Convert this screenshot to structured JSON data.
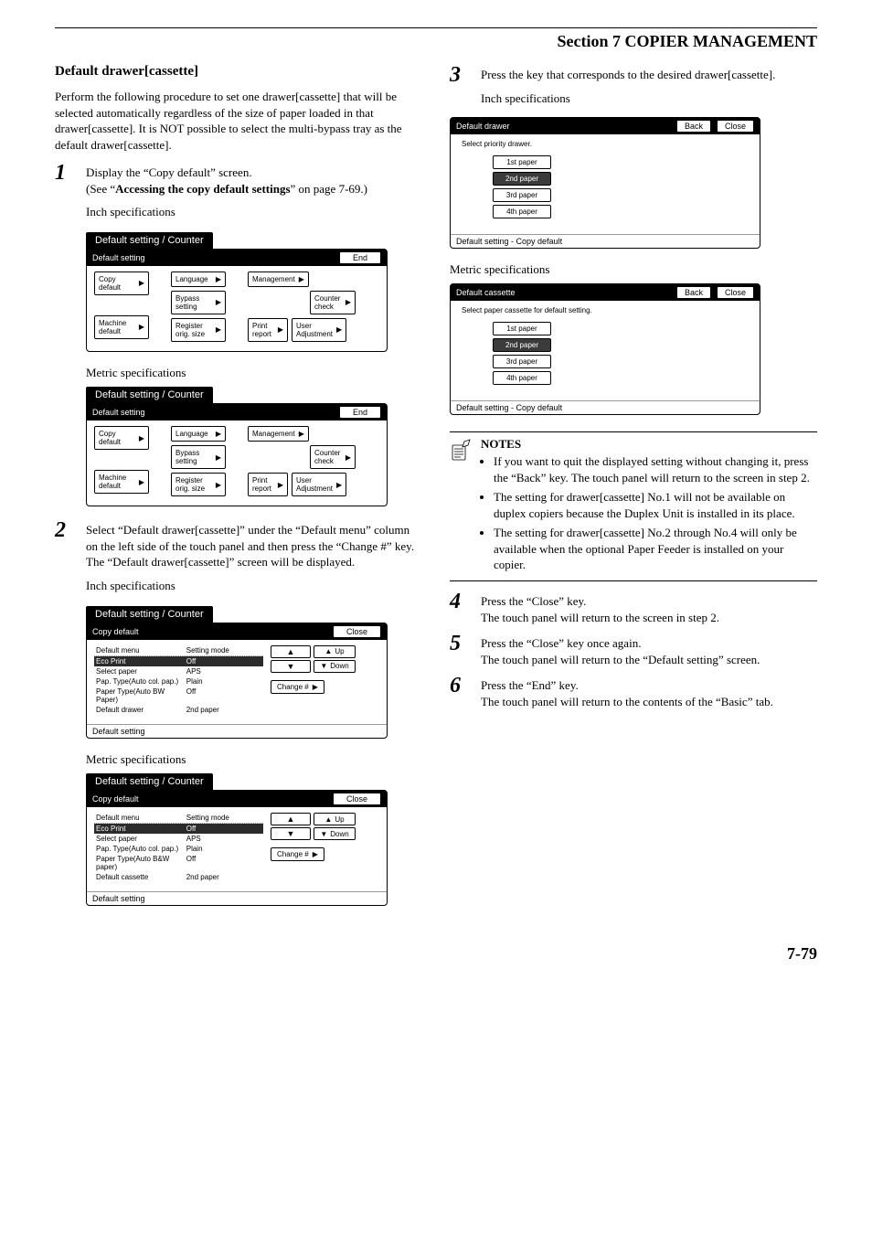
{
  "header": "Section 7  COPIER MANAGEMENT",
  "title": "Default drawer[cassette]",
  "intro": "Perform the following procedure to set one drawer[cassette] that will be selected automatically regardless of the size of paper loaded in that drawer[cassette]. It is NOT possible to select the multi-bypass tray as the default drawer[cassette].",
  "step1": {
    "num": "1",
    "line1": "Display the “Copy default” screen.",
    "line2a": "(See “",
    "line2b": "Accessing the copy default settings",
    "line2c": "” on page 7-69.)",
    "inch": "Inch specifications",
    "metric": "Metric specifications"
  },
  "panelA": {
    "tab": "Default setting / Counter",
    "bar": "Default setting",
    "end": "End",
    "btns": {
      "copy": "Copy\ndefault",
      "machine": "Machine\ndefault",
      "language": "Language",
      "bypass": "Bypass\nsetting",
      "register": "Register\norig. size",
      "management": "Management",
      "counter": "Counter\ncheck",
      "print": "Print\nreport",
      "user": "User\nAdjustment"
    }
  },
  "step2": {
    "num": "2",
    "text1": "Select “Default drawer[cassette]” under the “Default menu” column on the left side of the touch panel and then press the “Change #” key.",
    "text2": "The “Default drawer[cassette]” screen will be displayed.",
    "inch": "Inch specifications",
    "metric": "Metric specifications"
  },
  "panelB": {
    "tab": "Default setting / Counter",
    "bar": "Copy default",
    "close": "Close",
    "head1": "Default menu",
    "head2": "Setting mode",
    "up": "Up",
    "down": "Down",
    "change": "Change #",
    "footer": "Default setting",
    "inch_rows": [
      {
        "m": "Eco Print",
        "s": "Off",
        "sel": true
      },
      {
        "m": "Select paper",
        "s": "APS"
      },
      {
        "m": "Pap. Type(Auto col. pap.)",
        "s": "Plain"
      },
      {
        "m": "Paper Type(Auto BW Paper)",
        "s": "Off"
      },
      {
        "m": "Default drawer",
        "s": "2nd paper"
      }
    ],
    "metric_rows": [
      {
        "m": "Eco Print",
        "s": "Off",
        "sel": true
      },
      {
        "m": "Select paper",
        "s": "APS"
      },
      {
        "m": "Pap. Type(Auto col. pap.)",
        "s": "Plain"
      },
      {
        "m": "Paper Type(Auto B&W paper)",
        "s": "Off"
      },
      {
        "m": "Default cassette",
        "s": "2nd paper"
      }
    ]
  },
  "step3": {
    "num": "3",
    "text": "Press the key that corresponds to the desired drawer[cassette].",
    "inch": "Inch specifications",
    "metric": "Metric specifications"
  },
  "panelC": {
    "bar_inch": "Default drawer",
    "bar_metric": "Default cassette",
    "back": "Back",
    "close": "Close",
    "instr_inch": "Select priority drawer.",
    "instr_metric": "Select paper cassette for default setting.",
    "p1": "1st paper",
    "p2": "2nd paper",
    "p3": "3rd paper",
    "p4": "4th paper",
    "footer": "Default setting - Copy default"
  },
  "notes": {
    "title": "NOTES",
    "n1": "If you want to quit the displayed setting without changing it, press the “Back” key. The touch panel will return to the screen in step 2.",
    "n2": "The setting for drawer[cassette] No.1 will not be available on duplex copiers because the Duplex Unit is installed in its place.",
    "n3": "The setting for drawer[cassette] No.2 through No.4 will only be available when the optional Paper Feeder is installed on your copier."
  },
  "step4": {
    "num": "4",
    "l1": "Press the “Close” key.",
    "l2": "The touch panel will return to the screen in step 2."
  },
  "step5": {
    "num": "5",
    "l1": "Press the “Close” key once again.",
    "l2": "The touch panel will return to the “Default setting” screen."
  },
  "step6": {
    "num": "6",
    "l1": "Press the “End” key.",
    "l2": "The touch panel will return to the contents of the “Basic” tab."
  },
  "pagenum": "7-79"
}
